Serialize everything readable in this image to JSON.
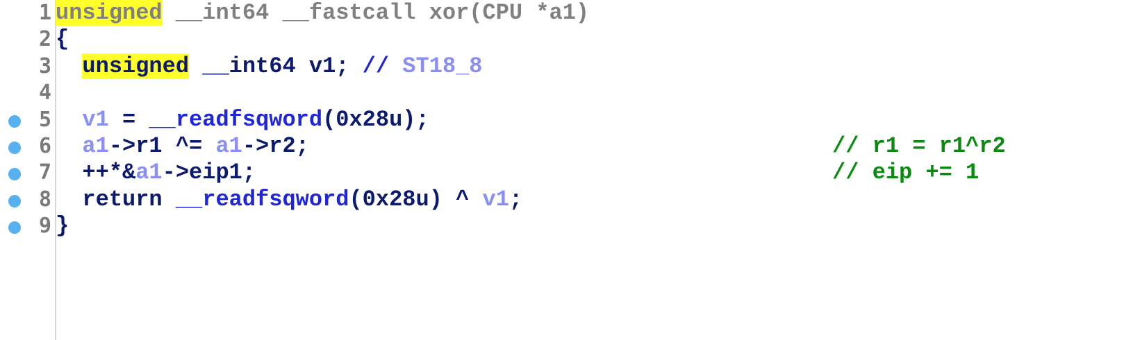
{
  "lines": [
    {
      "number": "1",
      "breakpoint": false,
      "tokens": [
        {
          "t": "unsigned",
          "c": "gray",
          "hl": true
        },
        {
          "t": " __int64 __fastcall xor(CPU *a1)",
          "c": "gray"
        }
      ]
    },
    {
      "number": "2",
      "breakpoint": false,
      "tokens": [
        {
          "t": "{",
          "c": "dark"
        }
      ]
    },
    {
      "number": "3",
      "breakpoint": false,
      "tokens": [
        {
          "t": "  ",
          "c": "dark"
        },
        {
          "t": "unsigned",
          "c": "dark",
          "hl": true
        },
        {
          "t": " __int64 v1; ",
          "c": "dark"
        },
        {
          "t": "// ",
          "c": "blue"
        },
        {
          "t": "ST18_8",
          "c": "light"
        }
      ]
    },
    {
      "number": "4",
      "breakpoint": false,
      "tokens": []
    },
    {
      "number": "5",
      "breakpoint": true,
      "tokens": [
        {
          "t": "  ",
          "c": "dark"
        },
        {
          "t": "v1",
          "c": "light"
        },
        {
          "t": " = ",
          "c": "dark"
        },
        {
          "t": "__readfsqword",
          "c": "blue"
        },
        {
          "t": "(0x28u);",
          "c": "dark"
        }
      ]
    },
    {
      "number": "6",
      "breakpoint": true,
      "tokens": [
        {
          "t": "  ",
          "c": "dark"
        },
        {
          "t": "a1",
          "c": "light"
        },
        {
          "t": "->r1 ^= ",
          "c": "dark"
        },
        {
          "t": "a1",
          "c": "light"
        },
        {
          "t": "->r2;",
          "c": "dark"
        }
      ],
      "comment": "// r1 = r1^r2"
    },
    {
      "number": "7",
      "breakpoint": true,
      "tokens": [
        {
          "t": "  ",
          "c": "dark"
        },
        {
          "t": "++*&",
          "c": "dark"
        },
        {
          "t": "a1",
          "c": "light"
        },
        {
          "t": "->eip1;",
          "c": "dark"
        }
      ],
      "comment": "// eip += 1"
    },
    {
      "number": "8",
      "breakpoint": true,
      "tokens": [
        {
          "t": "  ",
          "c": "dark"
        },
        {
          "t": "return ",
          "c": "dark"
        },
        {
          "t": "__readfsqword",
          "c": "blue"
        },
        {
          "t": "(0x28u) ^ ",
          "c": "dark"
        },
        {
          "t": "v1",
          "c": "light"
        },
        {
          "t": ";",
          "c": "dark"
        }
      ]
    },
    {
      "number": "9",
      "breakpoint": true,
      "tokens": [
        {
          "t": "}",
          "c": "dark"
        }
      ]
    }
  ],
  "colors": {
    "dark": "#0b1a6e",
    "blue": "#1f26d8",
    "light": "#8a8ff4",
    "green": "#0a8a10",
    "gray": "#808080",
    "highlight": "#ffff2a",
    "breakpoint": "#57b0ef",
    "line_number": "#7a7a7a"
  }
}
